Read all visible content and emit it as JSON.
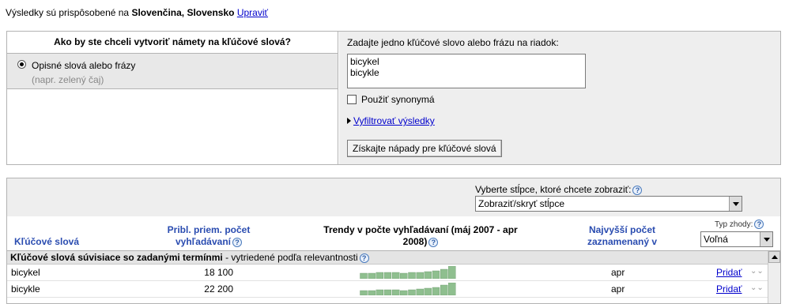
{
  "top": {
    "prefix": "Výsledky sú prispôsobené na",
    "locale": "Slovenčina, Slovensko",
    "edit_link": "Upraviť"
  },
  "ideas": {
    "question": "Ako by ste chceli vytvoriť námety na kľúčové slová?",
    "option_label": "Opisné slová alebo frázy",
    "option_hint": "(napr. zelený čaj)",
    "textarea_label": "Zadajte jedno kľúčové slovo alebo frázu na riadok:",
    "textarea_value": "bicykel\nbicykle",
    "synonyms_label": "Použiť synonymá",
    "filter_link": "Vyfiltrovať výsledky",
    "get_ideas_button": "Získajte nápady pre kľúčové slová"
  },
  "results": {
    "columns_label": "Vyberte stĺpce, ktoré chcete zobraziť:",
    "columns_select": "Zobraziť/skryť stĺpce",
    "match_type_label": "Typ zhody:",
    "match_type_value": "Voľná",
    "headers": {
      "keywords": "Kľúčové slová",
      "volume_line1": "Pribl. priem. počet",
      "volume_line2": "vyhľadávaní",
      "trends_line1": "Trendy v počte vyhľadávaní (máj 2007 - apr",
      "trends_line2": "2008)",
      "peak_line1": "Najvyšší počet",
      "peak_line2": "zaznamenaný v"
    },
    "section_title": "Kľúčové slová súvisiace so zadanými termínmi",
    "section_suffix": " - vytriedené podľa relevantnosti",
    "rows": [
      {
        "keyword": "bicykel",
        "volume": "18 100",
        "peak": "apr",
        "add": "Pridať",
        "trend": [
          0.42,
          0.45,
          0.48,
          0.5,
          0.47,
          0.45,
          0.5,
          0.52,
          0.55,
          0.6,
          0.78,
          1.0
        ]
      },
      {
        "keyword": "bicykle",
        "volume": "22 200",
        "peak": "apr",
        "add": "Pridať",
        "trend": [
          0.35,
          0.38,
          0.42,
          0.45,
          0.42,
          0.4,
          0.44,
          0.48,
          0.55,
          0.65,
          0.82,
          1.0
        ]
      }
    ],
    "colors": {
      "link": "#0000cc",
      "header_blue": "#2a4cb0",
      "spark": "#8fbf8f"
    }
  }
}
